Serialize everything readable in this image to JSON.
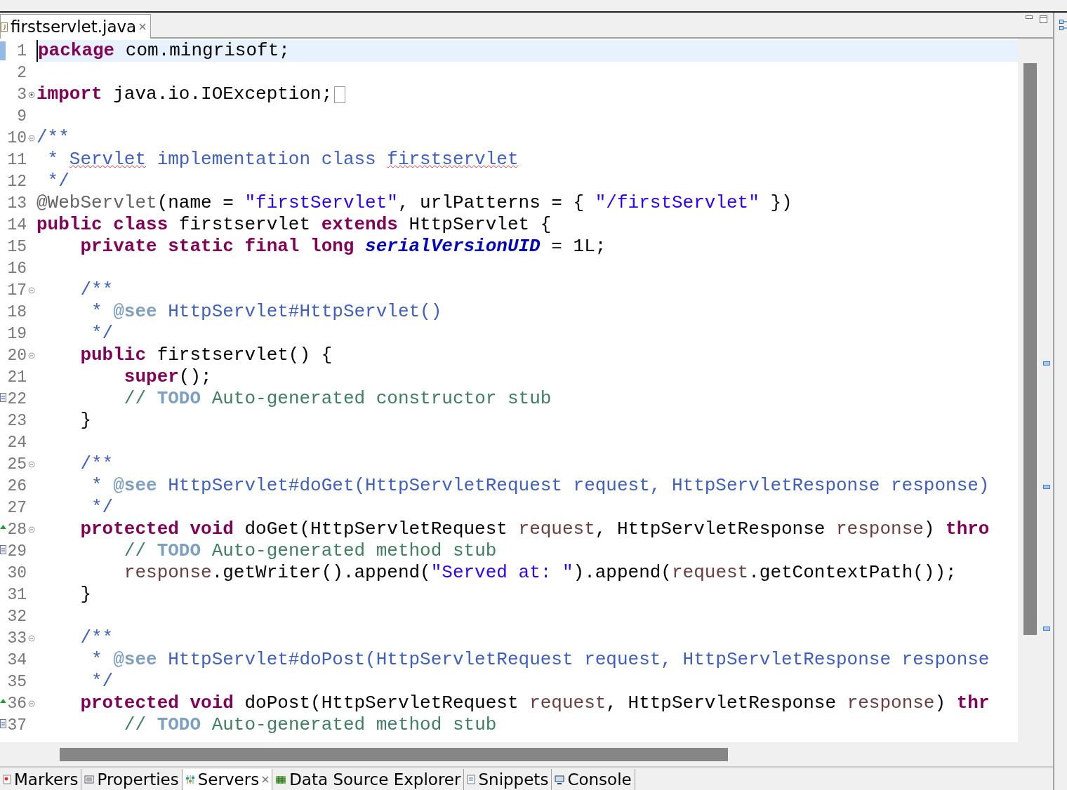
{
  "editor_tab": {
    "label": "firstservlet.java",
    "selected": true
  },
  "lines": [
    {
      "number": "1",
      "current": true,
      "changed": true,
      "tokens": [
        {
          "kind": "kw",
          "text": "package"
        },
        {
          "kind": "plain",
          "text": " com.mingrisoft;"
        }
      ]
    },
    {
      "number": "2",
      "current": false
    },
    {
      "number": "3",
      "current": false,
      "foldable": true,
      "collapsed": true,
      "tokens": [
        {
          "kind": "kw",
          "text": "import"
        },
        {
          "kind": "plain",
          "text": " java.io.IOException;"
        }
      ]
    },
    {
      "number": "9",
      "current": false
    },
    {
      "number": "10",
      "current": false,
      "foldable": true,
      "collapsed": false,
      "tokens": [
        {
          "kind": "doc",
          "text": "/**"
        }
      ]
    },
    {
      "number": "11",
      "current": false,
      "tokens": [
        {
          "kind": "doc",
          "text": " * "
        },
        {
          "kind": "docspell",
          "text": "Servlet"
        },
        {
          "kind": "doc",
          "text": " implementation class "
        },
        {
          "kind": "docspell",
          "text": "firstservlet"
        }
      ]
    },
    {
      "number": "12",
      "current": false,
      "tokens": [
        {
          "kind": "doc",
          "text": " */"
        }
      ]
    },
    {
      "number": "13",
      "current": false,
      "tokens": [
        {
          "kind": "anno",
          "text": "@WebServlet"
        },
        {
          "kind": "plain",
          "text": "(name = "
        },
        {
          "kind": "str",
          "text": "\"firstServlet\""
        },
        {
          "kind": "plain",
          "text": ", urlPatterns = { "
        },
        {
          "kind": "str",
          "text": "\"/firstServlet\""
        },
        {
          "kind": "plain",
          "text": " })"
        }
      ]
    },
    {
      "number": "14",
      "current": false,
      "tokens": [
        {
          "kind": "kw",
          "text": "public class"
        },
        {
          "kind": "plain",
          "text": " firstservlet "
        },
        {
          "kind": "kw",
          "text": "extends"
        },
        {
          "kind": "plain",
          "text": " HttpServlet {"
        }
      ]
    },
    {
      "number": "15",
      "current": false,
      "tokens": [
        {
          "kind": "kw",
          "text": "    private static final long "
        },
        {
          "kind": "field",
          "text": "serialVersionUID"
        },
        {
          "kind": "plain",
          "text": " = 1L;"
        }
      ]
    },
    {
      "number": "16",
      "current": false
    },
    {
      "number": "17",
      "current": false,
      "foldable": true,
      "collapsed": false,
      "tokens": [
        {
          "kind": "doc",
          "text": "    /**"
        }
      ]
    },
    {
      "number": "18",
      "current": false,
      "tokens": [
        {
          "kind": "doc",
          "text": "     * "
        },
        {
          "kind": "doctag",
          "text": "@see"
        },
        {
          "kind": "doc",
          "text": " HttpServlet#HttpServlet()"
        }
      ]
    },
    {
      "number": "19",
      "current": false,
      "tokens": [
        {
          "kind": "doc",
          "text": "     */"
        }
      ]
    },
    {
      "number": "20",
      "current": false,
      "foldable": true,
      "collapsed": false,
      "tokens": [
        {
          "kind": "kw",
          "text": "    public"
        },
        {
          "kind": "plain",
          "text": " firstservlet() {"
        }
      ]
    },
    {
      "number": "21",
      "current": false,
      "tokens": [
        {
          "kind": "kw",
          "text": "        super"
        },
        {
          "kind": "plain",
          "text": "();"
        }
      ]
    },
    {
      "number": "22",
      "current": false,
      "task": true,
      "tokens": [
        {
          "kind": "comment",
          "text": "        // "
        },
        {
          "kind": "todo",
          "text": "TODO"
        },
        {
          "kind": "comment",
          "text": " Auto-generated constructor stub"
        }
      ]
    },
    {
      "number": "23",
      "current": false,
      "tokens": [
        {
          "kind": "plain",
          "text": "    }"
        }
      ]
    },
    {
      "number": "24",
      "current": false
    },
    {
      "number": "25",
      "current": false,
      "foldable": true,
      "collapsed": false,
      "tokens": [
        {
          "kind": "doc",
          "text": "    /**"
        }
      ]
    },
    {
      "number": "26",
      "current": false,
      "tokens": [
        {
          "kind": "doc",
          "text": "     * "
        },
        {
          "kind": "doctag",
          "text": "@see"
        },
        {
          "kind": "doc",
          "text": " HttpServlet#doGet(HttpServletRequest request, HttpServletResponse response)"
        }
      ]
    },
    {
      "number": "27",
      "current": false,
      "tokens": [
        {
          "kind": "doc",
          "text": "     */"
        }
      ]
    },
    {
      "number": "28",
      "current": false,
      "foldable": true,
      "collapsed": false,
      "override": true,
      "tokens": [
        {
          "kind": "kw",
          "text": "    protected void"
        },
        {
          "kind": "plain",
          "text": " doGet(HttpServletRequest "
        },
        {
          "kind": "local",
          "text": "request"
        },
        {
          "kind": "plain",
          "text": ", HttpServletResponse "
        },
        {
          "kind": "local",
          "text": "response"
        },
        {
          "kind": "plain",
          "text": ") "
        },
        {
          "kind": "kw",
          "text": "thro"
        }
      ]
    },
    {
      "number": "29",
      "current": false,
      "task": true,
      "tokens": [
        {
          "kind": "comment",
          "text": "        // "
        },
        {
          "kind": "todo",
          "text": "TODO"
        },
        {
          "kind": "comment",
          "text": " Auto-generated method stub"
        }
      ]
    },
    {
      "number": "30",
      "current": false,
      "tokens": [
        {
          "kind": "local",
          "text": "        response"
        },
        {
          "kind": "plain",
          "text": ".getWriter().append("
        },
        {
          "kind": "str",
          "text": "\"Served at: \""
        },
        {
          "kind": "plain",
          "text": ").append("
        },
        {
          "kind": "local",
          "text": "request"
        },
        {
          "kind": "plain",
          "text": ".getContextPath());"
        }
      ]
    },
    {
      "number": "31",
      "current": false,
      "tokens": [
        {
          "kind": "plain",
          "text": "    }"
        }
      ]
    },
    {
      "number": "32",
      "current": false
    },
    {
      "number": "33",
      "current": false,
      "foldable": true,
      "collapsed": false,
      "tokens": [
        {
          "kind": "doc",
          "text": "    /**"
        }
      ]
    },
    {
      "number": "34",
      "current": false,
      "tokens": [
        {
          "kind": "doc",
          "text": "     * "
        },
        {
          "kind": "doctag",
          "text": "@see"
        },
        {
          "kind": "doc",
          "text": " HttpServlet#doPost(HttpServletRequest request, HttpServletResponse response"
        }
      ]
    },
    {
      "number": "35",
      "current": false,
      "tokens": [
        {
          "kind": "doc",
          "text": "     */"
        }
      ]
    },
    {
      "number": "36",
      "current": false,
      "foldable": true,
      "collapsed": false,
      "override": true,
      "tokens": [
        {
          "kind": "kw",
          "text": "    protected void"
        },
        {
          "kind": "plain",
          "text": " doPost(HttpServletRequest "
        },
        {
          "kind": "local",
          "text": "request"
        },
        {
          "kind": "plain",
          "text": ", HttpServletResponse "
        },
        {
          "kind": "local",
          "text": "response"
        },
        {
          "kind": "plain",
          "text": ") "
        },
        {
          "kind": "kw",
          "text": "thr"
        }
      ]
    },
    {
      "number": "37",
      "current": false,
      "task": true,
      "tokens": [
        {
          "kind": "comment",
          "text": "        // "
        },
        {
          "kind": "todo",
          "text": "TODO"
        },
        {
          "kind": "comment",
          "text": " Auto-generated method stub"
        }
      ]
    }
  ],
  "bottom_tabs": [
    {
      "label": "Markers",
      "kind": "markers",
      "selected": false
    },
    {
      "label": "Properties",
      "kind": "properties",
      "selected": false
    },
    {
      "label": "Servers",
      "kind": "servers",
      "selected": true
    },
    {
      "label": "Data Source Explorer",
      "kind": "datasource",
      "selected": false
    },
    {
      "label": "Snippets",
      "kind": "snippets",
      "selected": false
    },
    {
      "label": "Console",
      "kind": "console",
      "selected": false
    }
  ]
}
